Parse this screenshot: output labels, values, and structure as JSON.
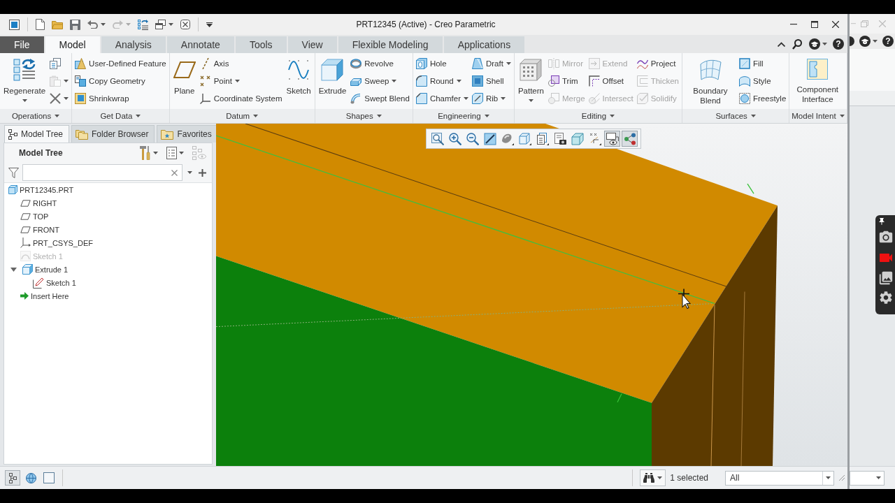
{
  "window": {
    "title": "PRT12345 (Active) - Creo Parametric"
  },
  "quick_access": [
    {
      "dropdown": false,
      "disabled": false
    },
    {
      "dropdown": false,
      "disabled": false
    },
    {
      "dropdown": false,
      "disabled": false
    },
    {
      "dropdown": true,
      "disabled": false
    },
    {
      "dropdown": true,
      "disabled": true
    },
    {
      "dropdown": false,
      "disabled": false
    },
    {
      "dropdown": true,
      "disabled": false
    },
    {
      "dropdown": false,
      "disabled": false
    }
  ],
  "tabs": [
    {
      "label": "File",
      "kind": "menu",
      "selected": false
    },
    {
      "label": "Model",
      "kind": "tab",
      "selected": true
    },
    {
      "label": "Analysis",
      "kind": "tab",
      "selected": false
    },
    {
      "label": "Annotate",
      "kind": "tab",
      "selected": false
    },
    {
      "label": "Tools",
      "kind": "tab",
      "selected": false
    },
    {
      "label": "View",
      "kind": "tab",
      "selected": false
    },
    {
      "label": "Flexible Modeling",
      "kind": "tab",
      "selected": false
    },
    {
      "label": "Applications",
      "kind": "tab",
      "selected": false
    }
  ],
  "help": "?",
  "ribbon": {
    "groups": [
      {
        "label": "Operations",
        "columns": [
          [
            {
              "kind": "large",
              "label": "Regenerate",
              "dropdown": true,
              "disabled": false
            }
          ],
          [
            {
              "kind": "icon",
              "dropdown": false,
              "disabled": false
            },
            {
              "kind": "icon",
              "dropdown": true,
              "disabled": true
            },
            {
              "kind": "icon",
              "dropdown": true,
              "disabled": false
            }
          ]
        ]
      },
      {
        "label": "Get Data",
        "columns": [
          [
            {
              "kind": "small",
              "label": "User-Defined Feature",
              "dropdown": false,
              "disabled": false
            },
            {
              "kind": "small",
              "label": "Copy Geometry",
              "dropdown": false,
              "disabled": false
            },
            {
              "kind": "small",
              "label": "Shrinkwrap",
              "dropdown": false,
              "disabled": false
            }
          ]
        ]
      },
      {
        "label": "Datum",
        "columns": [
          [
            {
              "kind": "large",
              "label": "Plane",
              "dropdown": false,
              "disabled": false
            }
          ],
          [
            {
              "kind": "small",
              "label": "Axis",
              "dropdown": false,
              "disabled": false
            },
            {
              "kind": "small",
              "label": "Point",
              "dropdown": true,
              "disabled": false
            },
            {
              "kind": "small",
              "label": "Coordinate System",
              "dropdown": false,
              "disabled": false
            }
          ],
          [
            {
              "kind": "large",
              "label": "Sketch",
              "dropdown": false,
              "disabled": false
            }
          ]
        ]
      },
      {
        "label": "Shapes",
        "columns": [
          [
            {
              "kind": "large",
              "label": "Extrude",
              "dropdown": false,
              "disabled": false
            }
          ],
          [
            {
              "kind": "small",
              "label": "Revolve",
              "dropdown": false,
              "disabled": false
            },
            {
              "kind": "small",
              "label": "Sweep",
              "dropdown": true,
              "disabled": false
            },
            {
              "kind": "small",
              "label": "Swept Blend",
              "dropdown": false,
              "disabled": false
            }
          ]
        ]
      },
      {
        "label": "Engineering",
        "columns": [
          [
            {
              "kind": "small",
              "label": "Hole",
              "dropdown": false,
              "disabled": false
            },
            {
              "kind": "small",
              "label": "Round",
              "dropdown": true,
              "disabled": false
            },
            {
              "kind": "small",
              "label": "Chamfer",
              "dropdown": true,
              "disabled": false
            }
          ],
          [
            {
              "kind": "small",
              "label": "Draft",
              "dropdown": true,
              "disabled": false
            },
            {
              "kind": "small",
              "label": "Shell",
              "dropdown": false,
              "disabled": false
            },
            {
              "kind": "small",
              "label": "Rib",
              "dropdown": true,
              "disabled": false
            }
          ]
        ]
      },
      {
        "label": "Editing",
        "columns": [
          [
            {
              "kind": "large",
              "label": "Pattern",
              "dropdown": true,
              "disabled": false
            }
          ],
          [
            {
              "kind": "small",
              "label": "Mirror",
              "dropdown": false,
              "disabled": true
            },
            {
              "kind": "small",
              "label": "Trim",
              "dropdown": false,
              "disabled": false
            },
            {
              "kind": "small",
              "label": "Merge",
              "dropdown": false,
              "disabled": true
            }
          ],
          [
            {
              "kind": "small",
              "label": "Extend",
              "dropdown": false,
              "disabled": true
            },
            {
              "kind": "small",
              "label": "Offset",
              "dropdown": false,
              "disabled": false
            },
            {
              "kind": "small",
              "label": "Intersect",
              "dropdown": false,
              "disabled": true
            }
          ],
          [
            {
              "kind": "small",
              "label": "Project",
              "dropdown": false,
              "disabled": false
            },
            {
              "kind": "small",
              "label": "Thicken",
              "dropdown": false,
              "disabled": true
            },
            {
              "kind": "small",
              "label": "Solidify",
              "dropdown": false,
              "disabled": true
            }
          ]
        ]
      },
      {
        "label": "Surfaces",
        "columns": [
          [
            {
              "kind": "large",
              "label": "Boundary Blend",
              "dropdown": false,
              "disabled": false
            }
          ],
          [
            {
              "kind": "small",
              "label": "Fill",
              "dropdown": false,
              "disabled": false
            },
            {
              "kind": "small",
              "label": "Style",
              "dropdown": false,
              "disabled": false
            },
            {
              "kind": "small",
              "label": "Freestyle",
              "dropdown": false,
              "disabled": false
            }
          ]
        ]
      },
      {
        "label": "Model Intent",
        "columns": [
          [
            {
              "kind": "large",
              "label": "Component Interface",
              "dropdown": false,
              "disabled": false
            }
          ]
        ]
      }
    ]
  },
  "panel": {
    "tabs": [
      {
        "label": "Model Tree",
        "selected": true
      },
      {
        "label": "Folder Browser",
        "selected": false
      },
      {
        "label": "Favorites",
        "selected": false
      }
    ],
    "title": "Model Tree",
    "tree": [
      {
        "label": "PRT12345.PRT",
        "kind": "part",
        "disabled": false,
        "children": [
          {
            "label": "RIGHT",
            "kind": "plane",
            "disabled": false
          },
          {
            "label": "TOP",
            "kind": "plane",
            "disabled": false
          },
          {
            "label": "FRONT",
            "kind": "plane",
            "disabled": false
          },
          {
            "label": "PRT_CSYS_DEF",
            "kind": "csys",
            "disabled": false
          },
          {
            "label": "Sketch 1",
            "kind": "sketch",
            "disabled": true
          },
          {
            "label": "Extrude 1",
            "kind": "extrude",
            "disabled": false,
            "expanded": true,
            "children": [
              {
                "label": "Sketch 1",
                "kind": "internal_sketch",
                "disabled": false
              }
            ]
          },
          {
            "label": "Insert Here",
            "kind": "insert",
            "disabled": false
          }
        ]
      }
    ]
  },
  "view_toolbar": [
    {
      "on": false
    },
    {
      "on": false
    },
    {
      "on": false
    },
    {
      "on": false
    },
    {
      "on": false
    },
    {
      "on": false
    },
    {
      "on": false
    },
    {
      "on": false
    },
    {
      "on": false
    },
    {
      "on": false
    },
    {
      "on": true
    },
    {
      "on": true
    }
  ],
  "status_bar": {
    "toggles": [
      {
        "on": true
      },
      {
        "on": false
      },
      {
        "on": false
      }
    ],
    "selection": "1 selected",
    "filter": "All"
  },
  "side_window": {
    "help": "?"
  }
}
